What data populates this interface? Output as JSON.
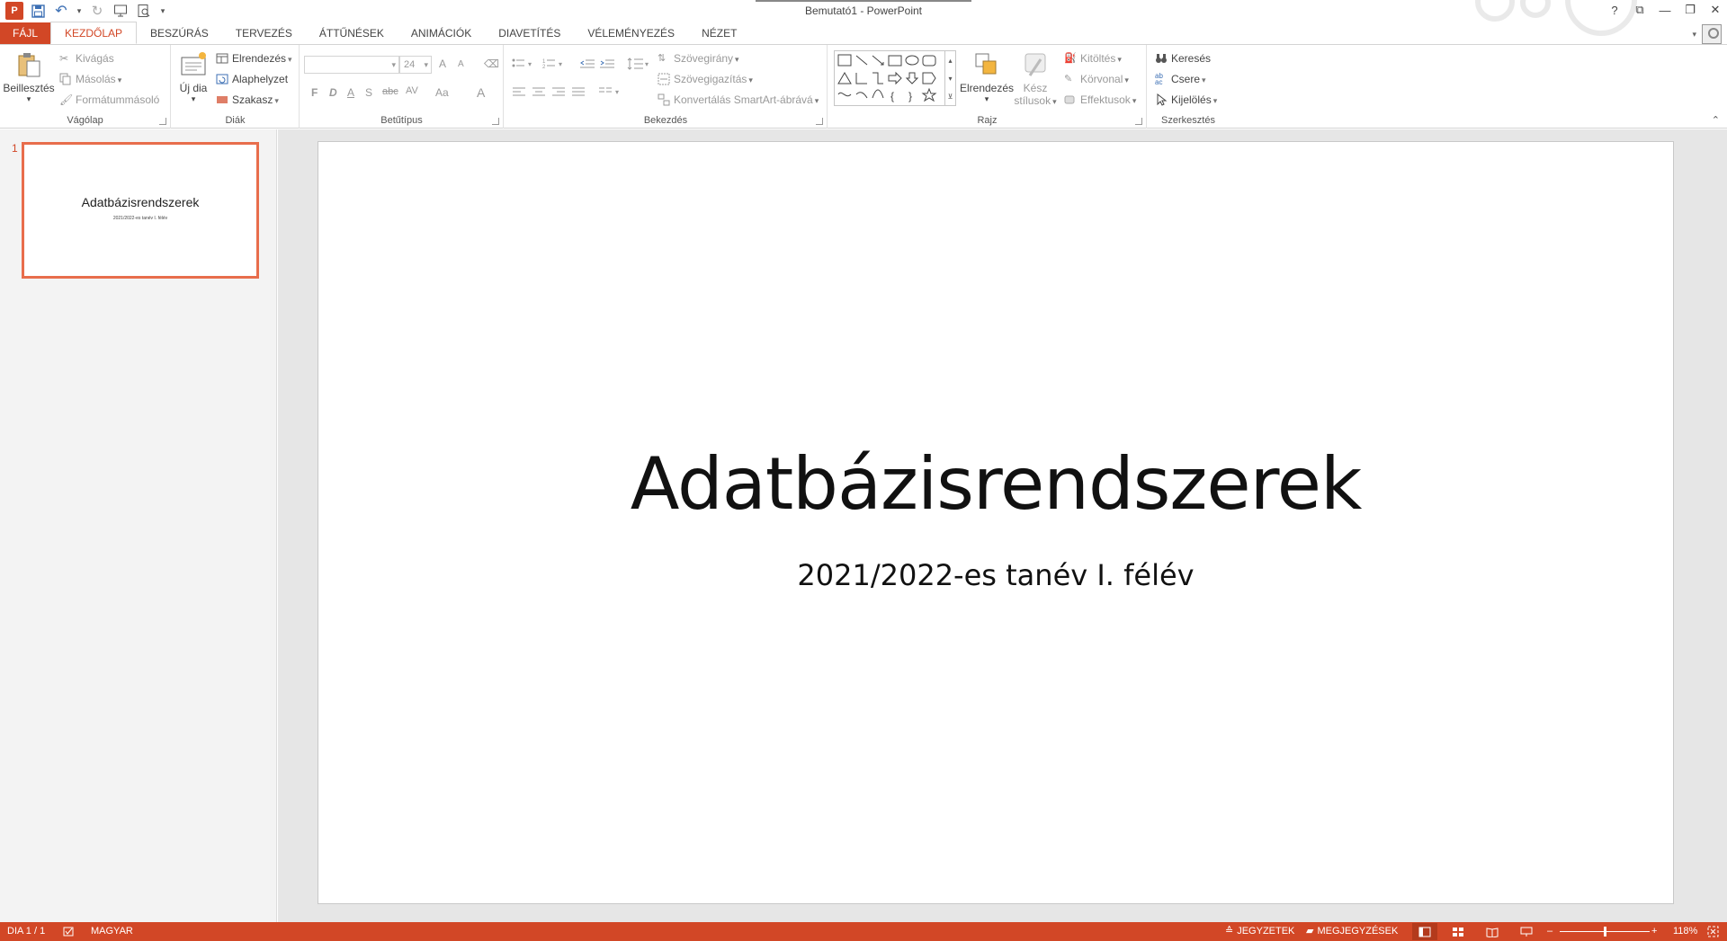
{
  "window": {
    "title": "Bemutató1 - PowerPoint",
    "help": "?",
    "ribbon_display": "⧉",
    "minimize": "—",
    "restore": "❐",
    "close": "✕"
  },
  "qat": {
    "app_logo": "P",
    "save": "💾",
    "undo": "↶",
    "undo_dd": "▾",
    "redo": "↻",
    "from_beginning": "▦",
    "preview": "🔍",
    "customize": "▾"
  },
  "tabs": [
    {
      "label": "FÁJL"
    },
    {
      "label": "KEZDŐLAP"
    },
    {
      "label": "BESZÚRÁS"
    },
    {
      "label": "TERVEZÉS"
    },
    {
      "label": "ÁTTŰNÉSEK"
    },
    {
      "label": "ANIMÁCIÓK"
    },
    {
      "label": "DIAVETÍTÉS"
    },
    {
      "label": "VÉLEMÉNYEZÉS"
    },
    {
      "label": "NÉZET"
    }
  ],
  "ribbon": {
    "clipboard": {
      "label": "Vágólap",
      "paste": "Beillesztés",
      "cut": "Kivágás",
      "copy": "Másolás",
      "format_painter": "Formátummásoló"
    },
    "slides": {
      "label": "Diák",
      "new_slide_line1": "Új dia",
      "layout": "Elrendezés",
      "reset": "Alaphelyzet",
      "section": "Szakasz"
    },
    "font": {
      "label": "Betűtípus",
      "font_name": "",
      "font_size": "24",
      "bold": "F",
      "italic": "D",
      "underline": "A",
      "shadow": "S",
      "strike": "abc",
      "spacing": "AV",
      "case": "Aa",
      "color": "A",
      "grow": "A",
      "shrink": "A"
    },
    "paragraph": {
      "label": "Bekezdés",
      "text_direction": "Szövegirány",
      "align_text": "Szövegigazítás",
      "smartart": "Konvertálás SmartArt-ábrává"
    },
    "drawing": {
      "label": "Rajz",
      "arrange": "Elrendezés",
      "quick_styles_1": "Kész",
      "quick_styles_2": "stílusok",
      "fill": "Kitöltés",
      "outline": "Körvonal",
      "effects": "Effektusok"
    },
    "editing": {
      "label": "Szerkesztés",
      "find": "Keresés",
      "replace": "Csere",
      "select": "Kijelölés"
    }
  },
  "thumbnails": [
    {
      "number": "1",
      "title": "Adatbázisrendszerek",
      "subtitle": "2021/2022-es tanév I. félév"
    }
  ],
  "slide": {
    "title": "Adatbázisrendszerek",
    "subtitle": "2021/2022-es tanév I. félév"
  },
  "status": {
    "slide_info": "DIA 1 / 1",
    "language": "MAGYAR",
    "notes": "JEGYZETEK",
    "comments": "MEGJEGYZÉSEK",
    "zoom_minus": "–",
    "zoom_plus": "+",
    "zoom_level": "118%",
    "zoom_fraction": 0.5
  },
  "colors": {
    "accent": "#d24726",
    "thumb_border": "#e86d4c"
  }
}
